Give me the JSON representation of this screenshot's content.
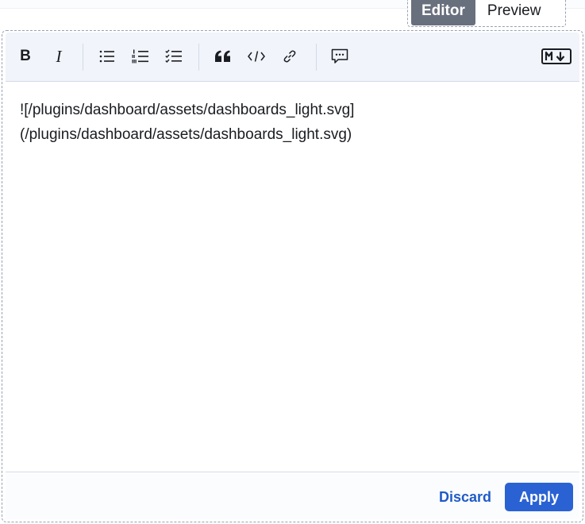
{
  "tabs": {
    "editor_label": "Editor",
    "preview_label": "Preview",
    "active": "Editor"
  },
  "toolbar": {
    "buttons": [
      {
        "name": "bold",
        "icon": "bold-icon"
      },
      {
        "name": "italic",
        "icon": "italic-icon"
      },
      {
        "name": "unordered-list",
        "icon": "bullet-list-icon"
      },
      {
        "name": "ordered-list",
        "icon": "numbered-list-icon"
      },
      {
        "name": "task-list",
        "icon": "checklist-icon"
      },
      {
        "name": "quote",
        "icon": "quote-icon"
      },
      {
        "name": "code",
        "icon": "code-icon"
      },
      {
        "name": "link",
        "icon": "link-icon"
      },
      {
        "name": "comment",
        "icon": "comment-icon"
      },
      {
        "name": "markdown",
        "icon": "markdown-icon"
      }
    ],
    "bold_label": "B",
    "italic_label": "I"
  },
  "editor": {
    "content": "![/plugins/dashboard/assets/dashboards_light.svg]\n(/plugins/dashboard/assets/dashboards_light.svg)"
  },
  "footer": {
    "discard_label": "Discard",
    "apply_label": "Apply"
  },
  "colors": {
    "accent": "#2a62d4",
    "link": "#1f5bc8",
    "tab_active_bg": "#69707d",
    "toolbar_bg": "#f1f4fa"
  }
}
